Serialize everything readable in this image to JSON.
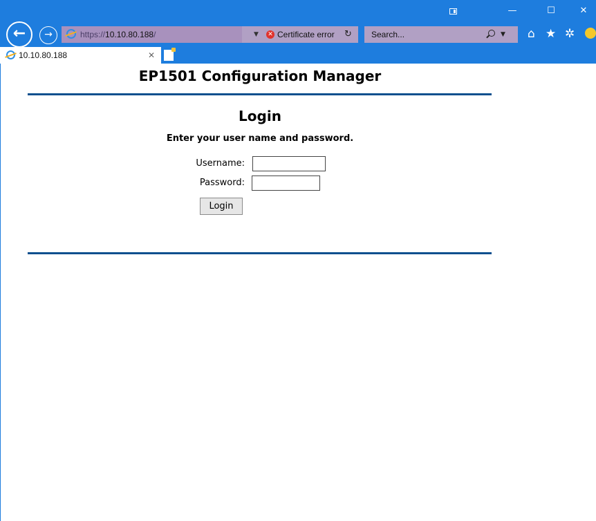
{
  "browser": {
    "url_protocol": "https://",
    "url_host": "10.10.80.188",
    "url_suffix": "/",
    "cert_error_label": "Certificate error",
    "search_placeholder": "Search...",
    "tab_title": "10.10.80.188",
    "icons": {
      "back": "back-arrow-icon",
      "forward": "forward-arrow-icon",
      "home": "home-icon",
      "favorites": "star-icon",
      "settings": "gear-icon",
      "feedback": "smiley-icon"
    },
    "theme_color": "#1e7dde",
    "address_bar_color": "#b1a0c4"
  },
  "page": {
    "title": "EP1501 Configuration Manager",
    "login_heading": "Login",
    "instructions": "Enter your user name and password.",
    "username_label": "Username:",
    "username_value": "",
    "password_label": "Password:",
    "password_value": "",
    "login_button": "Login",
    "rule_color": "#0a4f8e"
  }
}
